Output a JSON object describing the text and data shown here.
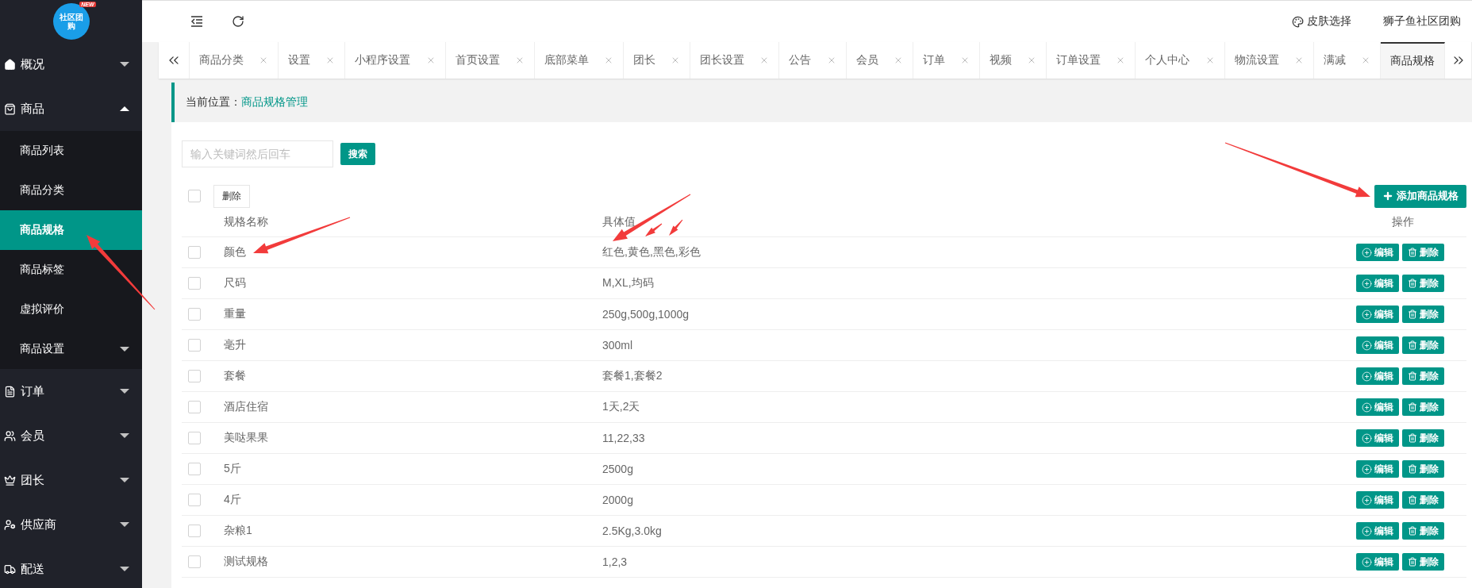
{
  "logo": {
    "text": "社区团购",
    "badge": "NEW"
  },
  "sidebar": {
    "items": [
      {
        "label": "概况",
        "expanded": false
      },
      {
        "label": "商品",
        "expanded": true,
        "children": [
          {
            "label": "商品列表",
            "selected": false
          },
          {
            "label": "商品分类",
            "selected": false
          },
          {
            "label": "商品规格",
            "selected": true
          },
          {
            "label": "商品标签",
            "selected": false
          },
          {
            "label": "虚拟评价",
            "selected": false
          },
          {
            "label": "商品设置",
            "selected": false,
            "expandable": true
          }
        ]
      },
      {
        "label": "订单",
        "expanded": false
      },
      {
        "label": "会员",
        "expanded": false
      },
      {
        "label": "团长",
        "expanded": false
      },
      {
        "label": "供应商",
        "expanded": false
      },
      {
        "label": "配送",
        "expanded": false
      }
    ]
  },
  "header": {
    "skin": "皮肤选择",
    "account": "狮子鱼社区团购"
  },
  "tabs": [
    {
      "label": "商品分类",
      "selected": false
    },
    {
      "label": "设置",
      "selected": false
    },
    {
      "label": "小程序设置",
      "selected": false
    },
    {
      "label": "首页设置",
      "selected": false
    },
    {
      "label": "底部菜单",
      "selected": false
    },
    {
      "label": "团长",
      "selected": false
    },
    {
      "label": "团长设置",
      "selected": false
    },
    {
      "label": "公告",
      "selected": false
    },
    {
      "label": "会员",
      "selected": false
    },
    {
      "label": "订单",
      "selected": false
    },
    {
      "label": "视频",
      "selected": false
    },
    {
      "label": "订单设置",
      "selected": false
    },
    {
      "label": "个人中心",
      "selected": false
    },
    {
      "label": "物流设置",
      "selected": false
    },
    {
      "label": "满减",
      "selected": false
    },
    {
      "label": "商品规格",
      "selected": true
    }
  ],
  "breadcrumb": {
    "label": "当前位置：",
    "current": "商品规格管理"
  },
  "search": {
    "placeholder": "输入关键词然后回车",
    "button": "搜索"
  },
  "toolbar": {
    "select_all_checked": false,
    "delete": "删除",
    "add": "添加商品规格"
  },
  "table": {
    "columns": [
      "规格名称",
      "具体值",
      "操作"
    ],
    "rows": [
      {
        "name": "颜色",
        "values": "红色,黄色,黑色,彩色",
        "checked": false,
        "edit": "编辑",
        "delete": "删除"
      },
      {
        "name": "尺码",
        "values": "M,XL,均码",
        "checked": false,
        "edit": "编辑",
        "delete": "删除"
      },
      {
        "name": "重量",
        "values": "250g,500g,1000g",
        "checked": false,
        "edit": "编辑",
        "delete": "删除"
      },
      {
        "name": "毫升",
        "values": "300ml",
        "checked": false,
        "edit": "编辑",
        "delete": "删除"
      },
      {
        "name": "套餐",
        "values": "套餐1,套餐2",
        "checked": false,
        "edit": "编辑",
        "delete": "删除"
      },
      {
        "name": "酒店住宿",
        "values": "1天,2天",
        "checked": false,
        "edit": "编辑",
        "delete": "删除"
      },
      {
        "name": "美哒果果",
        "values": "11,22,33",
        "checked": false,
        "edit": "编辑",
        "delete": "删除"
      },
      {
        "name": "5斤",
        "values": "2500g",
        "checked": false,
        "edit": "编辑",
        "delete": "删除"
      },
      {
        "name": "4斤",
        "values": "2000g",
        "checked": false,
        "edit": "编辑",
        "delete": "删除"
      },
      {
        "name": "杂粮1",
        "values": "2.5Kg,3.0kg",
        "checked": false,
        "edit": "编辑",
        "delete": "删除"
      },
      {
        "name": "测试规格",
        "values": "1,2,3",
        "checked": false,
        "edit": "编辑",
        "delete": "删除"
      }
    ]
  },
  "annotations": [
    {
      "kind": "arrow"
    },
    {
      "kind": "arrow"
    },
    {
      "kind": "arrow"
    },
    {
      "kind": "arrow"
    },
    {
      "kind": "arrow"
    },
    {
      "kind": "arrow"
    }
  ]
}
